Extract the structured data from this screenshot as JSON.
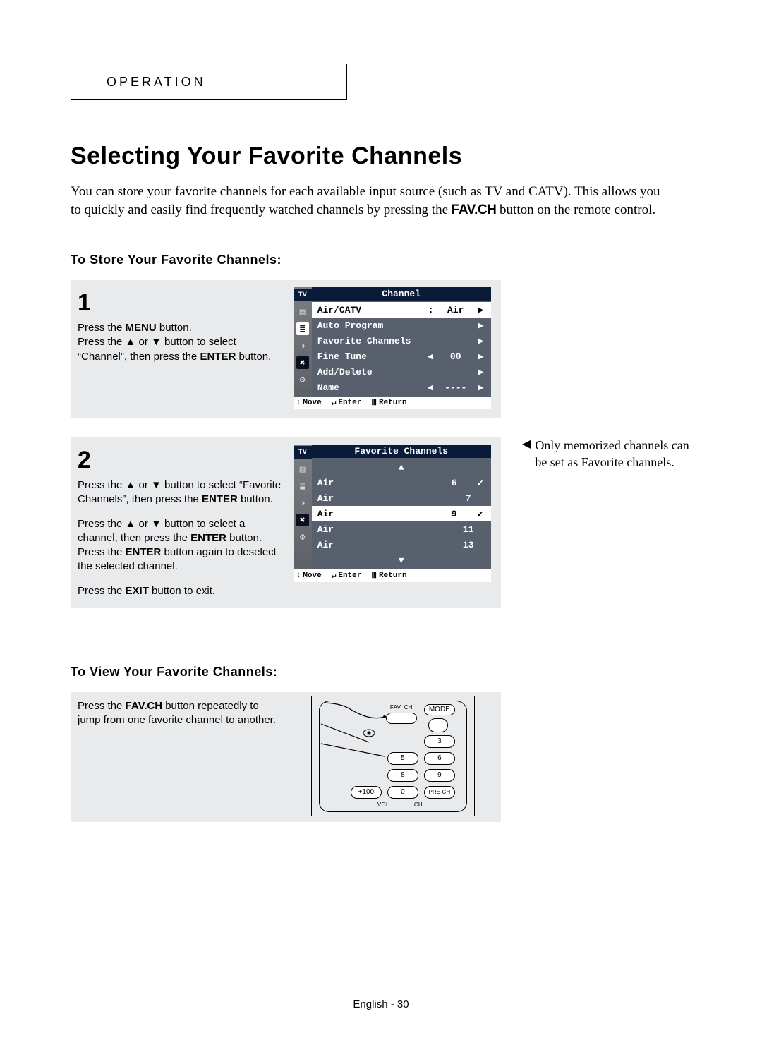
{
  "tab_label": "OPERATION",
  "title": "Selecting Your Favorite Channels",
  "intro_parts": {
    "p1": "You can store your favorite channels for each available input source (such as TV and CATV). This allows you to quickly and easily find frequently watched channels by pressing the ",
    "favch": "FAV.CH",
    "p2": " button on the remote control."
  },
  "sub_store": "To Store Your Favorite Channels:",
  "sub_view": "To View Your Favorite Channels:",
  "step1": {
    "num": "1",
    "l1a": "Press the ",
    "l1b_strong": "MENU",
    "l1c": " button.",
    "l2a": "Press the ▲ or ▼ button to select “Channel”, then press the ",
    "l2b_strong": "ENTER",
    "l2c": " button."
  },
  "step2": {
    "num": "2",
    "l1a": "Press the ▲ or ▼ button to select “Favorite Channels”, then press the ",
    "l1b_strong": "ENTER",
    "l1c": " button.",
    "l2a": "Press the ▲ or ▼ button to select a channel, then press the ",
    "l2b_strong": "ENTER",
    "l2c": " button.",
    "l3a": "Press the ",
    "l3b_strong": "ENTER",
    "l3c": " button again to deselect the selected channel.",
    "l4a": "Press the ",
    "l4b_strong": "EXIT",
    "l4c": " button to exit."
  },
  "step3": {
    "l1a": "Press the ",
    "l1b_strong": "FAV.CH",
    "l1c": " button repeatedly to jump from one favorite channel to another."
  },
  "note": "Only memorized channels can be set as Favorite channels.",
  "osd1": {
    "corner": "TV",
    "title": "Channel",
    "rows": [
      {
        "label": "Air/CATV",
        "colon": ":",
        "val": "Air",
        "rar": "▶",
        "sel": true
      },
      {
        "label": "Auto Program",
        "rar": "▶"
      },
      {
        "label": "Favorite Channels",
        "rar": "▶"
      },
      {
        "label": "Fine Tune",
        "lar": "◀",
        "val": "00",
        "rar": "▶"
      },
      {
        "label": "Add/Delete",
        "rar": "▶"
      },
      {
        "label": "Name",
        "lar": "◀",
        "val": "----",
        "rar": "▶"
      }
    ],
    "foot": {
      "move": "Move",
      "enter": "Enter",
      "ret": "Return",
      "move_icon": "↕",
      "enter_icon": "↵",
      "ret_icon": "Ⅲ"
    }
  },
  "osd2": {
    "corner": "TV",
    "title": "Favorite Channels",
    "rows": [
      {
        "center": "▲"
      },
      {
        "label": "Air",
        "val": "6",
        "chk": "✔"
      },
      {
        "label": "Air",
        "val": "7"
      },
      {
        "label": "Air",
        "val": "9",
        "chk": "✔",
        "sel": true
      },
      {
        "label": "Air",
        "val": "11"
      },
      {
        "label": "Air",
        "val": "13"
      },
      {
        "center": "▼"
      }
    ],
    "foot": {
      "move": "Move",
      "enter": "Enter",
      "ret": "Return",
      "move_icon": "↕",
      "enter_icon": "↵",
      "ret_icon": "Ⅲ"
    }
  },
  "remote": {
    "favch": "FAV. CH",
    "mode": "MODE",
    "prech": "PRE-CH",
    "plus100": "+100",
    "vol": "VOL",
    "ch": "CH",
    "b3": "3",
    "b5": "5",
    "b6": "6",
    "b8": "8",
    "b9": "9",
    "b0": "0"
  },
  "footer": "English - 30"
}
